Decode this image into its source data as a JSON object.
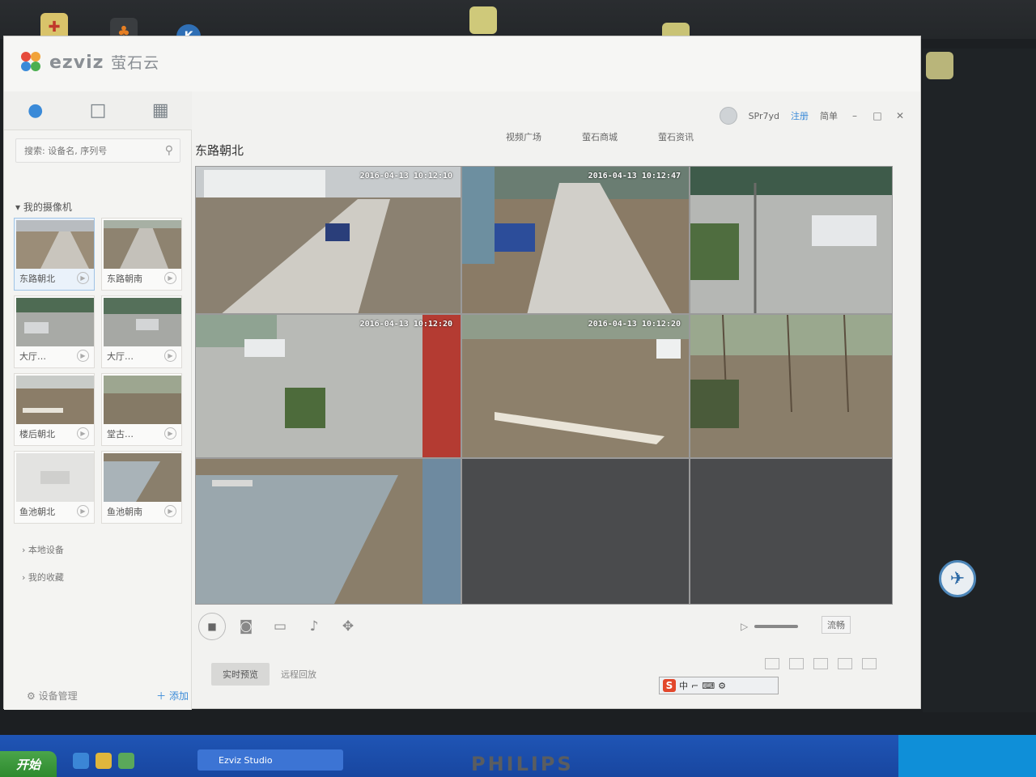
{
  "app": {
    "logo_text": "ezviz",
    "logo_cn": "萤石云"
  },
  "nav": {
    "icons": [
      "user-icon",
      "chat-icon",
      "grid-icon"
    ]
  },
  "user": {
    "name": "SPr7yd",
    "login_label": "注册",
    "lang_label": "简单"
  },
  "topnav": {
    "items": [
      "视频广场",
      "萤石商城",
      "萤石资讯"
    ]
  },
  "sidebar": {
    "search_placeholder": "搜索: 设备名, 序列号",
    "section_my_cameras": "我的摄像机",
    "cameras": [
      {
        "label": "东路朝北"
      },
      {
        "label": "东路朝南"
      },
      {
        "label": "大厅…"
      },
      {
        "label": "大厅…"
      },
      {
        "label": "楼后朝北"
      },
      {
        "label": "堂古…"
      },
      {
        "label": "鱼池朝北"
      },
      {
        "label": "鱼池朝南"
      }
    ],
    "local_devices": "本地设备",
    "favorites": "我的收藏",
    "device_mgmt": "设备管理",
    "add_label": "添加"
  },
  "main": {
    "camera_title": "东路朝北",
    "tiles": [
      {
        "timestamp": "2016-04-13 10:12:10",
        "caption": ""
      },
      {
        "timestamp": "2016-04-13 10:12:47",
        "caption": ""
      },
      {
        "timestamp": "",
        "caption": ""
      },
      {
        "timestamp": "2016-04-13 10:12:20",
        "caption": ""
      },
      {
        "timestamp": "2016-04-13 10:12:20",
        "caption": ""
      },
      {
        "timestamp": "",
        "caption": ""
      },
      {
        "timestamp": "",
        "caption": ""
      }
    ],
    "quality_label": "流畅",
    "tabs": [
      "实时预览",
      "远程回放"
    ]
  },
  "taskbar": {
    "start_label": "开始",
    "task_label": "Ezviz Studio"
  },
  "monitor_brand": "PHILIPS",
  "colors": {
    "accent": "#3a8ad8",
    "taskbar": "#1f55b5",
    "tile_empty": "#4a4b4d"
  }
}
